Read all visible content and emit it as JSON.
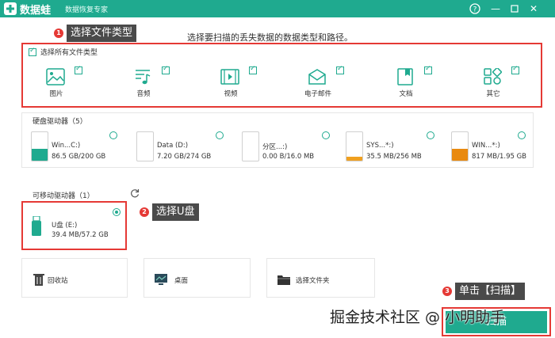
{
  "titlebar": {
    "app_name": "数据蛙",
    "subtitle": "数据恢复专家",
    "help_icon": "question-circle-icon",
    "minimize_icon": "minimize-icon",
    "maximize_icon": "maximize-icon",
    "close_icon": "close-icon",
    "accent": "#1faa8f"
  },
  "instruction": "选择要扫描的丢失数据的数据类型和路径。",
  "annotations": {
    "step1": {
      "num": "1",
      "label": "选择文件类型"
    },
    "step2": {
      "num": "2",
      "label": "选择U盘"
    },
    "step3": {
      "num": "3",
      "label": "单击【扫描】"
    },
    "highlight_color": "#e53935"
  },
  "file_types": {
    "select_all_label": "选择所有文件类型",
    "items": [
      {
        "label": "图片",
        "icon": "image-icon",
        "checked": true
      },
      {
        "label": "音频",
        "icon": "audio-icon",
        "checked": true
      },
      {
        "label": "视频",
        "icon": "video-icon",
        "checked": true
      },
      {
        "label": "电子邮件",
        "icon": "email-icon",
        "checked": true
      },
      {
        "label": "文档",
        "icon": "document-icon",
        "checked": true
      },
      {
        "label": "其它",
        "icon": "other-icon",
        "checked": true
      }
    ]
  },
  "hard_drives": {
    "title": "硬盘驱动器（5）",
    "items": [
      {
        "name": "Win...C:)",
        "size": "86.5 GB/200 GB",
        "fill_color": "#1faa8f",
        "used_fraction": 0.43
      },
      {
        "name": "Data (D:)",
        "size": "7.20 GB/274 GB",
        "fill_color": "#1faa8f",
        "used_fraction": 0.03
      },
      {
        "name": "分区...:)",
        "size": "0.00  B/16.0 MB",
        "fill_color": "#1faa8f",
        "used_fraction": 0.0
      },
      {
        "name": "SYS...*:)",
        "size": "35.5 MB/256 MB",
        "fill_color": "#f0a020",
        "used_fraction": 0.14
      },
      {
        "name": "WIN...*:)",
        "size": "817 MB/1.95 GB",
        "fill_color": "#e98a10",
        "used_fraction": 0.42
      }
    ]
  },
  "removable": {
    "title": "可移动驱动器（1）",
    "refresh_icon": "refresh-icon",
    "items": [
      {
        "name": "U盘 (E:)",
        "size": "39.4 MB/57.2 GB",
        "icon": "usb-drive-icon",
        "selected": true
      }
    ]
  },
  "locations": [
    {
      "label": "回收站",
      "icon": "recycle-bin-icon"
    },
    {
      "label": "桌面",
      "icon": "desktop-icon"
    },
    {
      "label": "选择文件夹",
      "icon": "folder-icon"
    }
  ],
  "scan_button": {
    "label": "扫描"
  },
  "watermark": "掘金技术社区 @ 小明助手"
}
